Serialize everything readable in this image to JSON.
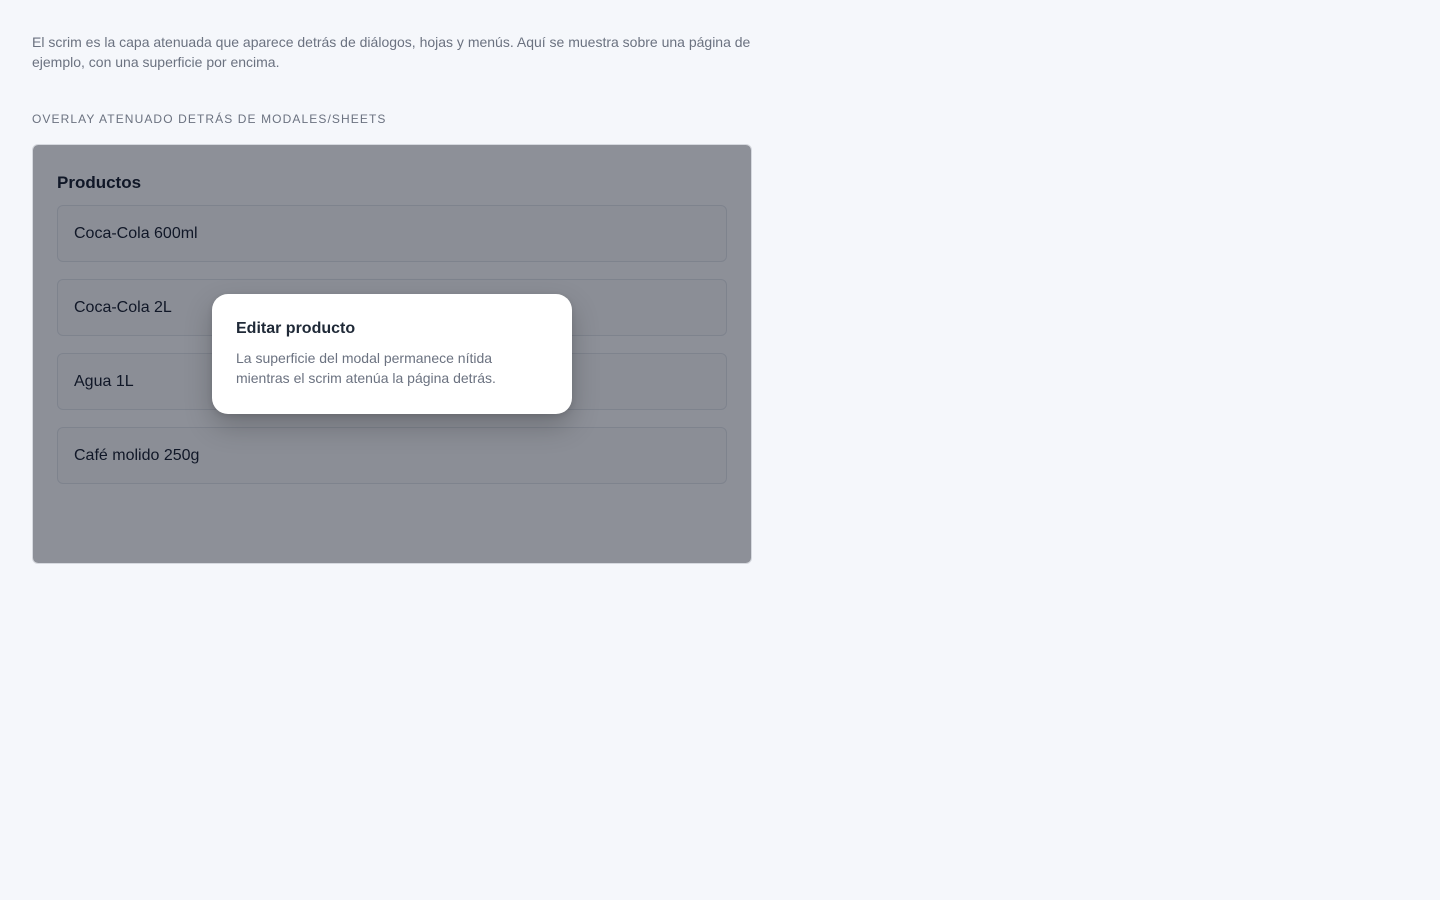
{
  "intro": {
    "text": "El scrim es la capa atenuada que aparece detrás de diálogos, hojas y menús. Aquí se muestra sobre una página de ejemplo, con una superficie por encima."
  },
  "section": {
    "label": "OVERLAY ATENUADO DETRÁS DE MODALES/SHEETS"
  },
  "demo": {
    "page_title": "Productos",
    "products": [
      {
        "name": "Coca-Cola 600ml"
      },
      {
        "name": "Coca-Cola 2L"
      },
      {
        "name": "Agua 1L"
      },
      {
        "name": "Café molido 250g"
      }
    ],
    "modal": {
      "title": "Editar producto",
      "body": "La superficie del modal permanece nítida mientras el scrim atenúa la página detrás."
    }
  },
  "colors": {
    "background": "#f5f7fb",
    "scrim": "rgba(17,24,39,0.48)",
    "surface": "#ffffff",
    "muted_text": "#6b7280",
    "primary_text": "#111827"
  }
}
